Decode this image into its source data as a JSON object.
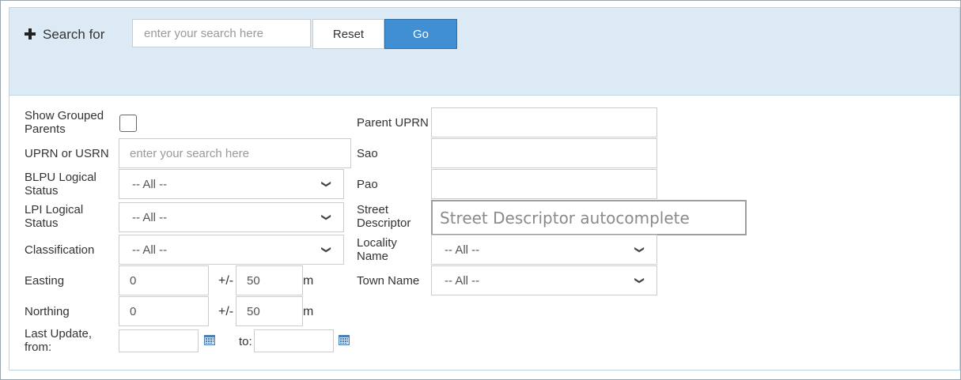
{
  "search": {
    "title": "Search for",
    "placeholder": "enter your search here",
    "reset_label": "Reset",
    "go_label": "Go"
  },
  "colors": {
    "header_bg": "#dbeaf5",
    "go_button": "#3f8fd2",
    "border": "#cccccc"
  },
  "icons": {
    "expand": "plus-icon",
    "date_picker": "calendar-icon",
    "dropdown": "chevron-down-icon"
  },
  "left": {
    "show_grouped_parents_label": "Show Grouped Parents",
    "uprn_usrn_label": "UPRN or USRN",
    "uprn_usrn_placeholder": "enter your search here",
    "blpu_label": "BLPU Logical Status",
    "blpu_value": "-- All --",
    "lpi_label": "LPI Logical Status",
    "lpi_value": "-- All --",
    "classification_label": "Classification",
    "classification_value": "-- All --",
    "easting_label": "Easting",
    "easting_value": "0",
    "easting_tolerance_label": "+/-",
    "easting_tolerance": "50",
    "easting_unit": "m",
    "northing_label": "Northing",
    "northing_value": "0",
    "northing_tolerance_label": "+/-",
    "northing_tolerance": "50",
    "northing_unit": "m",
    "last_update_label": "Last Update, from:",
    "last_update_from": "",
    "to_label": "to:",
    "last_update_to": ""
  },
  "right": {
    "parent_uprn_label": "Parent UPRN",
    "parent_uprn_value": "",
    "sao_label": "Sao",
    "sao_value": "",
    "pao_label": "Pao",
    "pao_value": "",
    "street_descriptor_label": "Street Descriptor",
    "street_descriptor_placeholder": "Street Descriptor autocomplete",
    "locality_label": "Locality Name",
    "locality_value": "-- All --",
    "town_label": "Town Name",
    "town_value": "-- All --"
  }
}
